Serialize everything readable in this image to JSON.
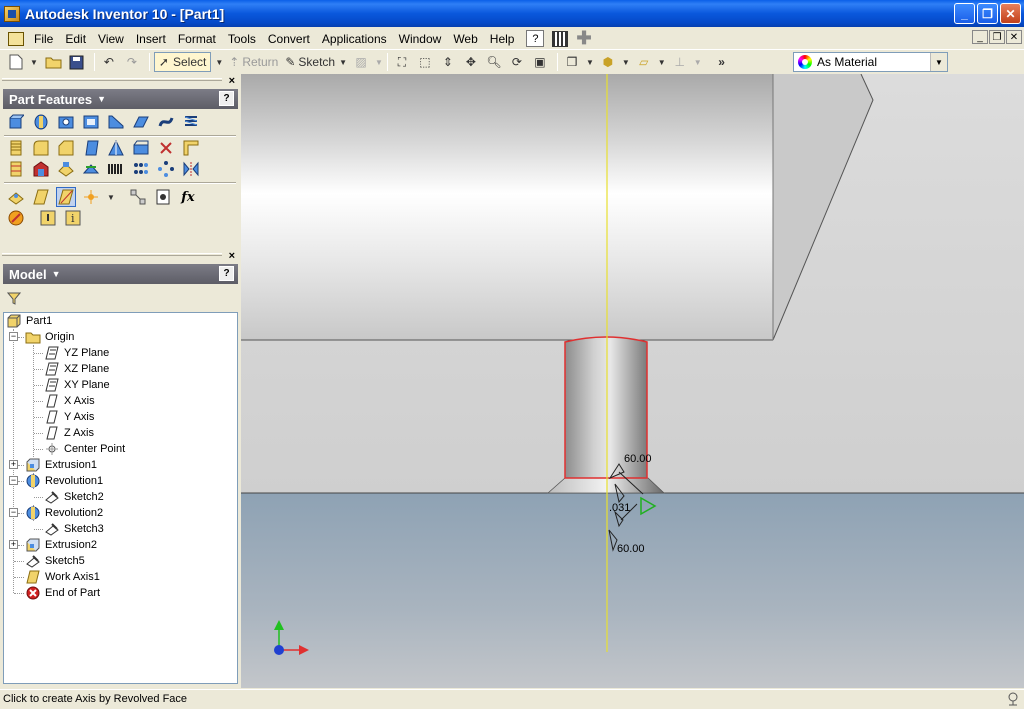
{
  "window": {
    "title": "Autodesk Inventor 10 - [Part1]",
    "minimize": "_",
    "maximize": "❐",
    "close": "✕"
  },
  "menu": {
    "items": [
      "File",
      "Edit",
      "View",
      "Insert",
      "Format",
      "Tools",
      "Convert",
      "Applications",
      "Window",
      "Web",
      "Help"
    ],
    "help_icon": "?"
  },
  "toolbar": {
    "select_label": "Select",
    "return_label": "Return",
    "sketch_label": "Sketch",
    "material_value": "As Material"
  },
  "panels": {
    "features": {
      "title": "Part Features",
      "close": "×",
      "help": "?"
    },
    "model": {
      "title": "Model",
      "close": "×",
      "help": "?"
    }
  },
  "tree": [
    {
      "label": "Part1",
      "icon": "part-icon"
    },
    {
      "label": "Origin",
      "icon": "folder-icon"
    },
    {
      "label": "YZ Plane",
      "icon": "plane-icon"
    },
    {
      "label": "XZ Plane",
      "icon": "plane-icon"
    },
    {
      "label": "XY Plane",
      "icon": "plane-icon"
    },
    {
      "label": "X Axis",
      "icon": "axis-icon"
    },
    {
      "label": "Y Axis",
      "icon": "axis-icon"
    },
    {
      "label": "Z Axis",
      "icon": "axis-icon"
    },
    {
      "label": "Center Point",
      "icon": "point-icon"
    },
    {
      "label": "Extrusion1",
      "icon": "extrusion-icon"
    },
    {
      "label": "Revolution1",
      "icon": "revolution-icon"
    },
    {
      "label": "Sketch2",
      "icon": "sketch-icon"
    },
    {
      "label": "Revolution2",
      "icon": "revolution-icon"
    },
    {
      "label": "Sketch3",
      "icon": "sketch-icon"
    },
    {
      "label": "Extrusion2",
      "icon": "extrusion-icon"
    },
    {
      "label": "Sketch5",
      "icon": "sketch-icon"
    },
    {
      "label": "Work Axis1",
      "icon": "work-axis-icon"
    },
    {
      "label": "End of Part",
      "icon": "end-of-part-icon"
    }
  ],
  "viewport": {
    "dim_top": "60.00",
    "dim_mid": ".031",
    "dim_bottom": "60.00"
  },
  "status": {
    "text": "Click to create Axis by Revolved Face"
  },
  "colors": {
    "titlebar": "#0a58dc",
    "panel_header": "#6b6b75",
    "highlight_edge": "#e03030",
    "axis_line": "#e8e030",
    "floor": "#8fa3b4"
  }
}
